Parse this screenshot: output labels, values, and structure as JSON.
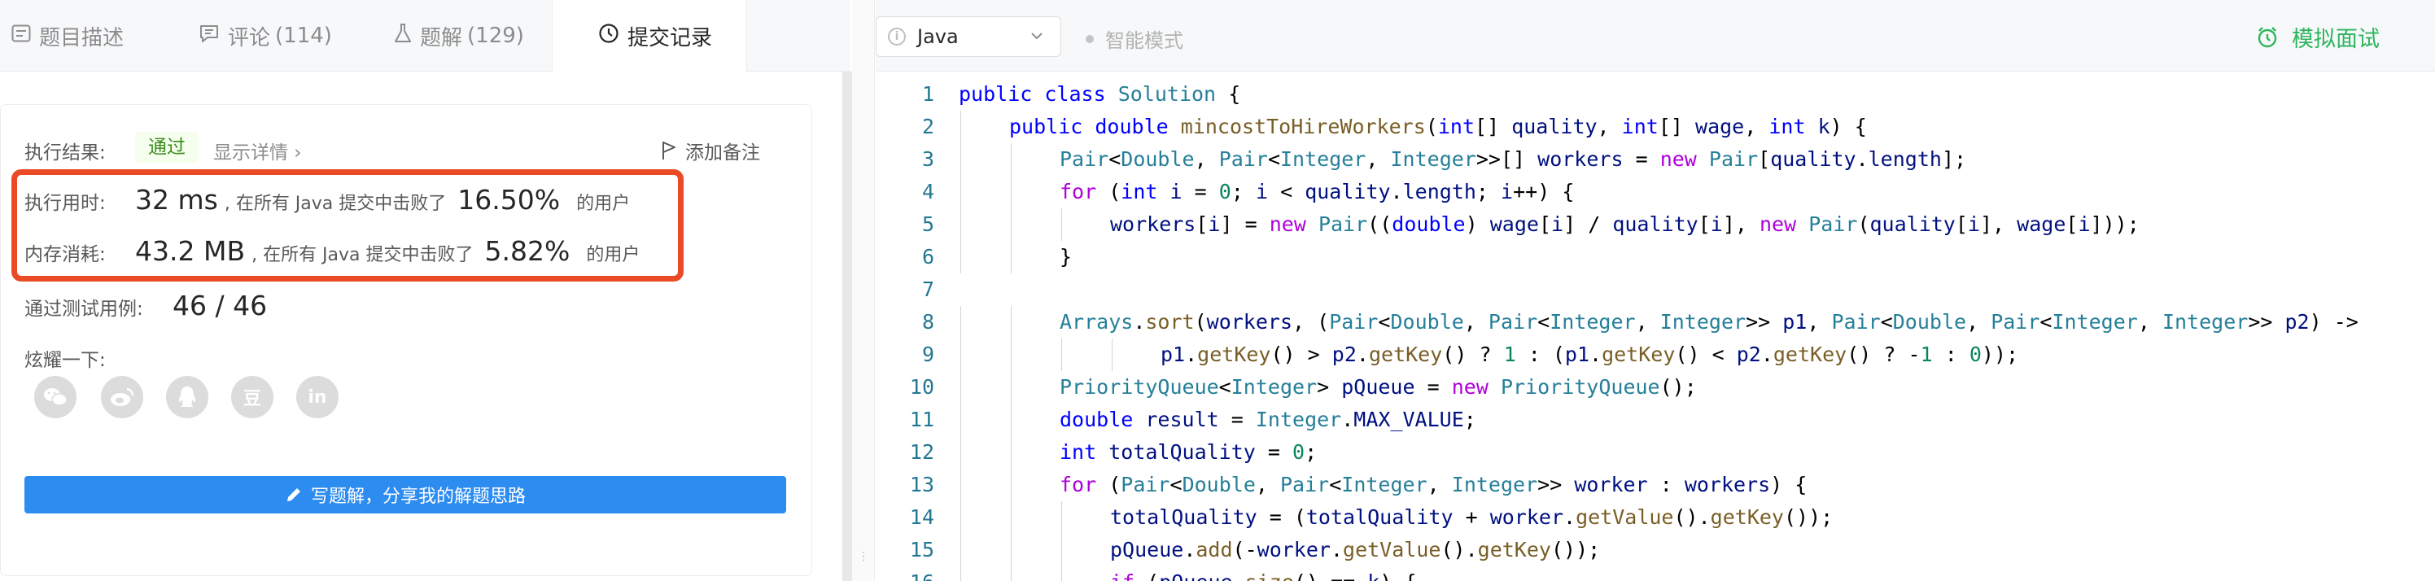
{
  "left_tabs": {
    "description": "题目描述",
    "comments": "评论",
    "comments_count": "(114)",
    "solutions": "题解",
    "solutions_count": "(129)",
    "submissions": "提交记录"
  },
  "result": {
    "label": "执行结果:",
    "status": "通过",
    "detail_link": "显示详情 ›",
    "add_note": "添加备注"
  },
  "runtime": {
    "label": "执行用时:",
    "value": "32 ms",
    "middle": ", 在所有 Java 提交中击败了",
    "percent": "16.50%",
    "tail": "的用户"
  },
  "memory": {
    "label": "内存消耗:",
    "value": "43.2 MB",
    "middle": ", 在所有 Java 提交中击败了",
    "percent": "5.82%",
    "tail": "的用户"
  },
  "tests": {
    "label": "通过测试用例:",
    "value": "46 / 46"
  },
  "share": {
    "label": "炫耀一下:",
    "icons": [
      "wechat-icon",
      "weibo-icon",
      "qq-icon",
      "douban-icon",
      "linkedin-icon"
    ],
    "douban_glyph": "豆",
    "linkedin_glyph": "in"
  },
  "write_button": "写题解，分享我的解题思路",
  "editor_header": {
    "language": "Java",
    "smart_mode": "智能模式",
    "mock_interview": "模拟面试"
  },
  "colors": {
    "accent_blue": "#2d8cf0",
    "pass_green": "#3a8c1e",
    "mock_green": "#2db55d",
    "highlight_red": "#ea4a26"
  },
  "code_lines": [
    {
      "n": "1",
      "indent": 0,
      "text": "public class Solution {"
    },
    {
      "n": "2",
      "indent": 1,
      "text": "public double mincostToHireWorkers(int[] quality, int[] wage, int k) {"
    },
    {
      "n": "3",
      "indent": 2,
      "text": "Pair<Double, Pair<Integer, Integer>>[] workers = new Pair[quality.length];"
    },
    {
      "n": "4",
      "indent": 2,
      "text": "for (int i = 0; i < quality.length; i++) {"
    },
    {
      "n": "5",
      "indent": 3,
      "text": "workers[i] = new Pair((double) wage[i] / quality[i], new Pair(quality[i], wage[i]));"
    },
    {
      "n": "6",
      "indent": 2,
      "text": "}"
    },
    {
      "n": "7",
      "indent": 0,
      "text": ""
    },
    {
      "n": "8",
      "indent": 2,
      "text": "Arrays.sort(workers, (Pair<Double, Pair<Integer, Integer>> p1, Pair<Double, Pair<Integer, Integer>> p2) ->"
    },
    {
      "n": "9",
      "indent": 4,
      "text": "p1.getKey() > p2.getKey() ? 1 : (p1.getKey() < p2.getKey() ? -1 : 0));"
    },
    {
      "n": "10",
      "indent": 2,
      "text": "PriorityQueue<Integer> pQueue = new PriorityQueue();"
    },
    {
      "n": "11",
      "indent": 2,
      "text": "double result = Integer.MAX_VALUE;"
    },
    {
      "n": "12",
      "indent": 2,
      "text": "int totalQuality = 0;"
    },
    {
      "n": "13",
      "indent": 2,
      "text": "for (Pair<Double, Pair<Integer, Integer>> worker : workers) {"
    },
    {
      "n": "14",
      "indent": 3,
      "text": "totalQuality = (totalQuality + worker.getValue().getKey());"
    },
    {
      "n": "15",
      "indent": 3,
      "text": "pQueue.add(-worker.getValue().getKey());"
    },
    {
      "n": "16",
      "indent": 3,
      "text": "if (pQueue.size() == k) {"
    }
  ]
}
